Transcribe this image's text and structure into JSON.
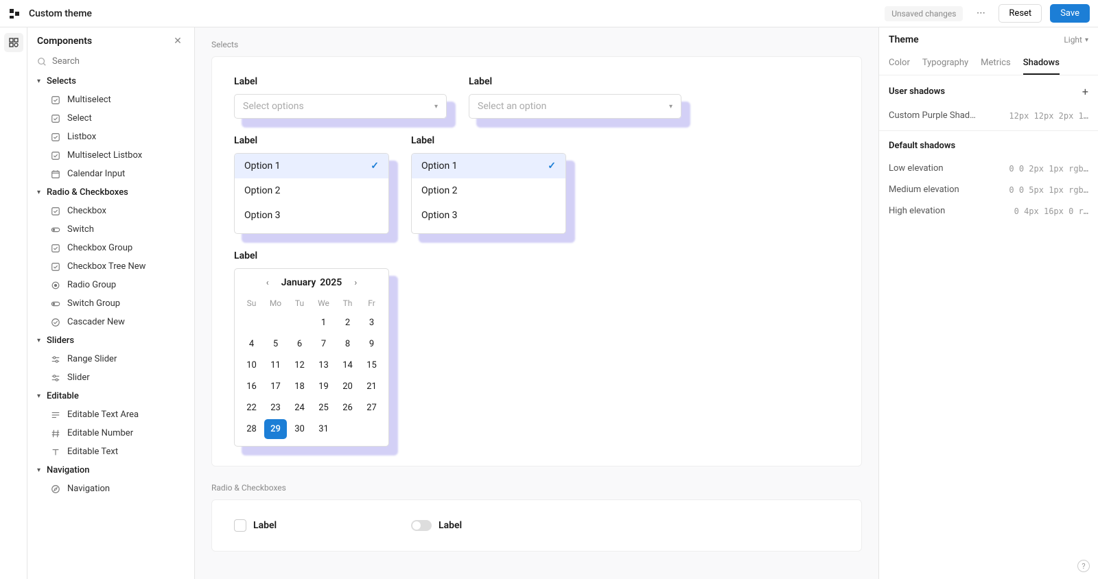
{
  "header": {
    "title": "Custom theme",
    "unsaved": "Unsaved changes",
    "reset": "Reset",
    "save": "Save"
  },
  "sidebar": {
    "title": "Components",
    "search_placeholder": "Search",
    "groups": [
      {
        "label": "Selects",
        "items": [
          {
            "label": "Multiselect",
            "icon": "check-square"
          },
          {
            "label": "Select",
            "icon": "check-square"
          },
          {
            "label": "Listbox",
            "icon": "check-square"
          },
          {
            "label": "Multiselect Listbox",
            "icon": "check-square"
          },
          {
            "label": "Calendar Input",
            "icon": "calendar"
          }
        ]
      },
      {
        "label": "Radio & Checkboxes",
        "items": [
          {
            "label": "Checkbox",
            "icon": "check-square"
          },
          {
            "label": "Switch",
            "icon": "toggle"
          },
          {
            "label": "Checkbox Group",
            "icon": "check-square"
          },
          {
            "label": "Checkbox Tree New",
            "icon": "check-square"
          },
          {
            "label": "Radio Group",
            "icon": "radio"
          },
          {
            "label": "Switch Group",
            "icon": "toggle"
          },
          {
            "label": "Cascader New",
            "icon": "check-circle"
          }
        ]
      },
      {
        "label": "Sliders",
        "items": [
          {
            "label": "Range Slider",
            "icon": "sliders"
          },
          {
            "label": "Slider",
            "icon": "sliders"
          }
        ]
      },
      {
        "label": "Editable",
        "items": [
          {
            "label": "Editable Text Area",
            "icon": "text-area"
          },
          {
            "label": "Editable Number",
            "icon": "hash"
          },
          {
            "label": "Editable Text",
            "icon": "text"
          }
        ]
      },
      {
        "label": "Navigation",
        "items": [
          {
            "label": "Navigation",
            "icon": "compass"
          }
        ]
      }
    ]
  },
  "canvas": {
    "section1": {
      "heading": "Selects",
      "select1": {
        "label": "Label",
        "placeholder": "Select options"
      },
      "select2": {
        "label": "Label",
        "placeholder": "Select an option"
      },
      "listbox1": {
        "label": "Label",
        "options": [
          "Option 1",
          "Option 2",
          "Option 3"
        ],
        "selected": 0
      },
      "listbox2": {
        "label": "Label",
        "options": [
          "Option 1",
          "Option 2",
          "Option 3"
        ],
        "selected": 0
      },
      "calendar": {
        "label": "Label",
        "month": "January",
        "year": "2025",
        "dow": [
          "Su",
          "Mo",
          "Tu",
          "We",
          "Th",
          "Fr"
        ],
        "lead_blanks": 3,
        "days": 31,
        "today": 29
      }
    },
    "section2": {
      "heading": "Radio & Checkboxes",
      "checkbox_label": "Label",
      "switch_label": "Label"
    }
  },
  "right": {
    "title": "Theme",
    "mode": "Light",
    "tabs": [
      "Color",
      "Typography",
      "Metrics",
      "Shadows"
    ],
    "active_tab": 3,
    "user_shadows_title": "User shadows",
    "user_shadows": [
      {
        "name": "Custom Purple Shad…",
        "value": "12px 12px 2px 1…"
      }
    ],
    "default_shadows_title": "Default shadows",
    "default_shadows": [
      {
        "name": "Low elevation",
        "value": "0 0 2px 1px rgb…"
      },
      {
        "name": "Medium elevation",
        "value": "0 0 5px 1px rgb…"
      },
      {
        "name": "High elevation",
        "value": "0 4px 16px 0 r…"
      }
    ]
  }
}
